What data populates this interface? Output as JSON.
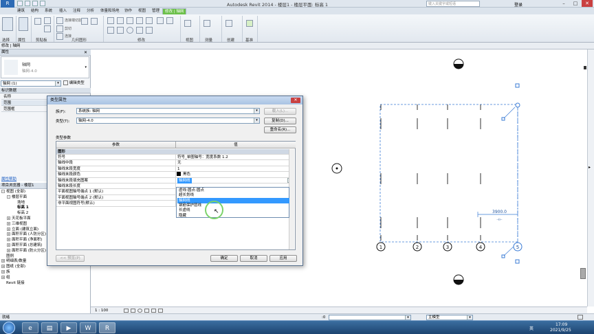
{
  "window": {
    "title": "Autodesk Revit 2014 -    楼层1 - 楼层平面: 标高 1",
    "search_placeholder": "键入关键字或短语",
    "user": "登录",
    "min": "–",
    "max": "□",
    "close": "✕"
  },
  "ribbon": {
    "tabs": [
      "建筑",
      "结构",
      "系统",
      "插入",
      "注释",
      "分析",
      "体量和场地",
      "协作",
      "视图",
      "管理",
      "修改 | 轴网"
    ],
    "context_tab": "修改 | 轴网",
    "groups": [
      "选择",
      "属性",
      "剪贴板",
      "几何图形",
      "修改",
      "视图",
      "测量",
      "创建",
      "基准"
    ],
    "small_labels": [
      "连接端切割",
      "剪切",
      "连接"
    ]
  },
  "option_bar": {
    "text": "修改 | 轴网"
  },
  "properties": {
    "header": "属性",
    "type_name": "轴网",
    "type_sub": "轴网-4.0",
    "filter": "轴网 (1)",
    "edit_type": "编辑类型",
    "section1": "标识数据",
    "rows": [
      {
        "name": "名称",
        "value": "1"
      },
      {
        "name": "范围",
        "value": ""
      },
      {
        "name": "范围框",
        "value": ""
      }
    ],
    "help": "属性帮助"
  },
  "browser": {
    "header": "项目浏览器 - 楼层1",
    "items": [
      {
        "indent": 0,
        "exp": "-",
        "label": "视图 (全部)"
      },
      {
        "indent": 1,
        "exp": "-",
        "label": "楼层平面"
      },
      {
        "indent": 2,
        "exp": "",
        "label": "场地"
      },
      {
        "indent": 2,
        "exp": "",
        "label": "标高 1"
      },
      {
        "indent": 2,
        "exp": "",
        "label": "标高 2"
      },
      {
        "indent": 1,
        "exp": "+",
        "label": "天花板平面"
      },
      {
        "indent": 1,
        "exp": "+",
        "label": "三维视图"
      },
      {
        "indent": 1,
        "exp": "+",
        "label": "立面 (建筑立面)"
      },
      {
        "indent": 1,
        "exp": "+",
        "label": "面积平面 (人防分区)"
      },
      {
        "indent": 1,
        "exp": "+",
        "label": "面积平面 (净面积)"
      },
      {
        "indent": 1,
        "exp": "+",
        "label": "面积平面 (总建筑)"
      },
      {
        "indent": 1,
        "exp": "+",
        "label": "面积平面 (防火分区)"
      },
      {
        "indent": 0,
        "exp": "",
        "label": "图例"
      },
      {
        "indent": 0,
        "exp": "+",
        "label": "明细表/数量"
      },
      {
        "indent": 0,
        "exp": "+",
        "label": "图纸 (全部)"
      },
      {
        "indent": 0,
        "exp": "+",
        "label": "族"
      },
      {
        "indent": 0,
        "exp": "+",
        "label": "组"
      },
      {
        "indent": 0,
        "exp": "",
        "label": "Revit 链接"
      }
    ]
  },
  "dialog": {
    "title": "类型属性",
    "family_label": "族(F):",
    "family_value": "系统族: 轴网",
    "type_label": "类型(T):",
    "type_value": "轴网-4.0",
    "load": "载入(L)...",
    "duplicate": "复制(D)...",
    "rename": "重命名(R)...",
    "type_params": "类型参数",
    "col_param": "参数",
    "col_value": "值",
    "group": "图形",
    "rows": [
      {
        "name": "符号",
        "value": "符号_单圈轴号：宽度系数 1.2"
      },
      {
        "name": "轴线中段",
        "value": "无"
      },
      {
        "name": "轴线末段宽度",
        "value": "1"
      },
      {
        "name": "轴线末段颜色",
        "value": "黑色"
      },
      {
        "name": "轴线末段填充图案",
        "value": "轴网线"
      },
      {
        "name": "轴线末段长度",
        "value": ""
      },
      {
        "name": "平面视图轴号端点 1 (默认)",
        "value": ""
      },
      {
        "name": "平面视图轴号端点 2 (默认)",
        "value": ""
      },
      {
        "name": "非平面视图符号(默认)",
        "value": ""
      }
    ],
    "dropdown": [
      "虚线-圆点-圆点",
      "超长划线",
      "轴网线",
      "钢筋保护层线",
      "长虚线",
      "隐藏"
    ],
    "dropdown_selected": 2,
    "preview": "<< 预览(P)",
    "ok": "确定",
    "cancel": "取消",
    "apply": "应用"
  },
  "canvas": {
    "grid_labels": [
      "1",
      "2",
      "3",
      "4",
      "5"
    ],
    "dimension": "3900.0",
    "scale": "1 : 100"
  },
  "status": {
    "text": "就绪",
    "model": "主模型",
    "zero": ":0"
  },
  "taskbar": {
    "time": "17:09",
    "date": "2021/9/25",
    "lang": "英"
  }
}
